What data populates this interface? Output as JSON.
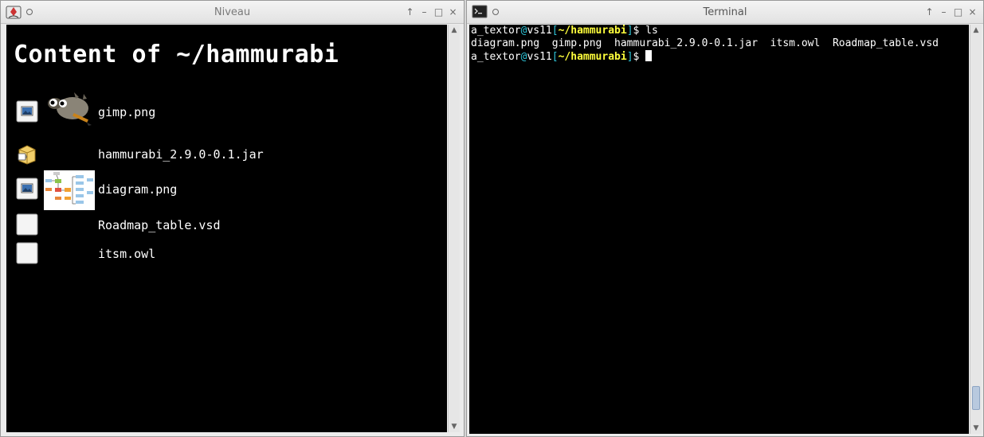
{
  "left_window": {
    "title": "Niveau",
    "buttons": {
      "up": "↑",
      "minimize": "–",
      "maximize": "□",
      "close": "×"
    },
    "heading": "Content of ~/hammurabi",
    "files": [
      {
        "name": "gimp.png",
        "type_icon": "image-file-icon",
        "thumbnail": "gimp-mascot-thumbnail"
      },
      {
        "name": "hammurabi_2.9.0-0.1.jar",
        "type_icon": "java-archive-icon",
        "thumbnail": ""
      },
      {
        "name": "diagram.png",
        "type_icon": "image-file-icon",
        "thumbnail": "diagram-thumbnail"
      },
      {
        "name": "Roadmap_table.vsd",
        "type_icon": "blank-file-icon",
        "thumbnail": ""
      },
      {
        "name": "itsm.owl",
        "type_icon": "blank-file-icon",
        "thumbnail": ""
      }
    ]
  },
  "terminal_window": {
    "title": "Terminal",
    "buttons": {
      "up": "↑",
      "minimize": "–",
      "maximize": "□",
      "close": "×"
    },
    "prompt": {
      "user": "a_textor",
      "at": "@",
      "host": "vs11",
      "open": "[",
      "dir": "~/hammurabi",
      "close": "]",
      "symbol": "$ "
    },
    "command_1": "ls",
    "output_1": "diagram.png  gimp.png  hammurabi_2.9.0-0.1.jar  itsm.owl  Roadmap_table.vsd"
  },
  "colors": {
    "terminal_bg": "#000000",
    "prompt_dir": "#ffff3c",
    "prompt_punct": "#2ec3d6",
    "scroll_thumb": "#b8c9de"
  }
}
